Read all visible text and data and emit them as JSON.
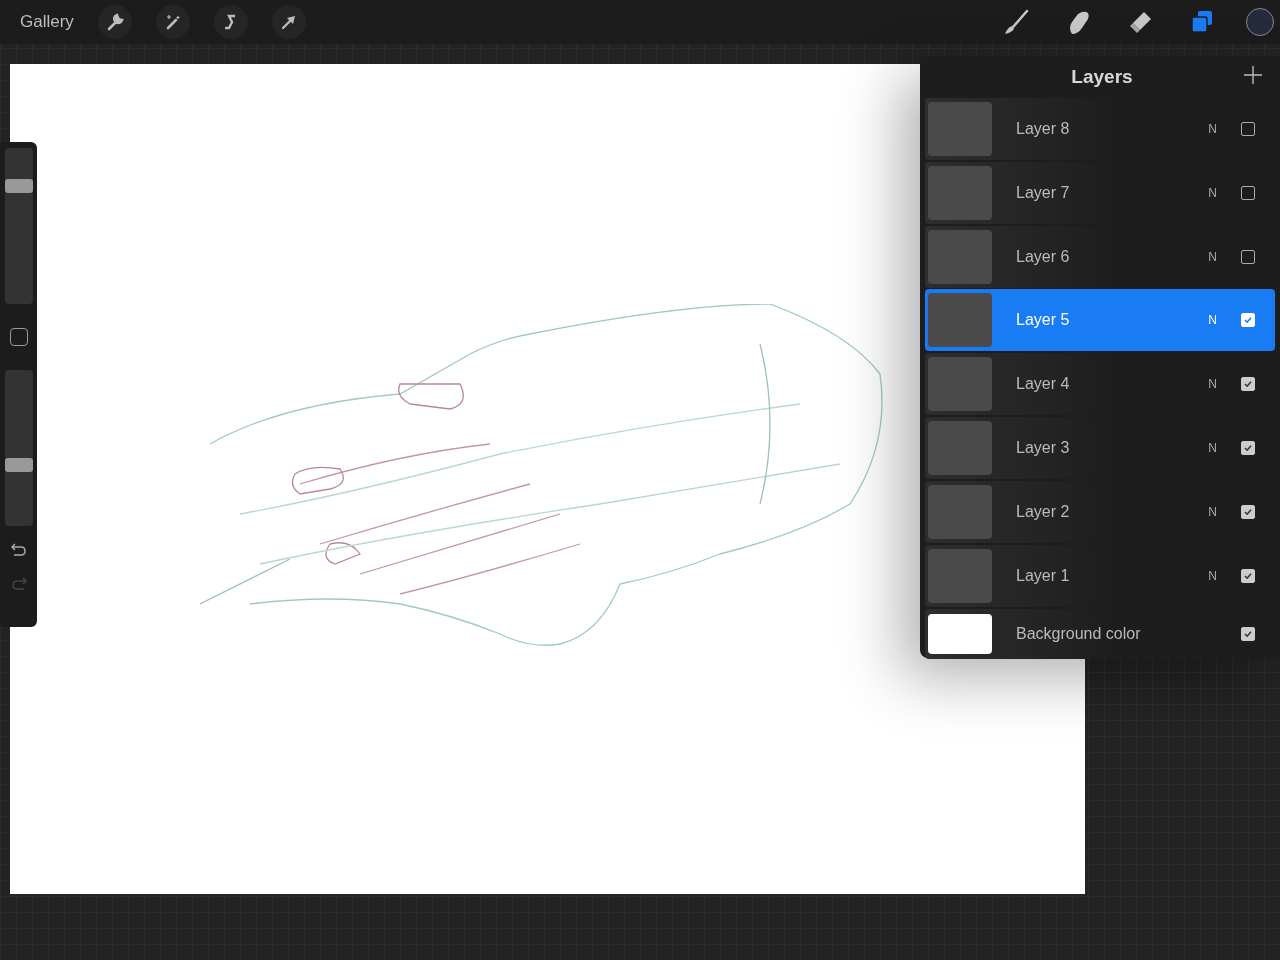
{
  "top_bar": {
    "gallery": "Gallery",
    "left_tools": [
      {
        "kind": "wrench"
      },
      {
        "kind": "wand"
      },
      {
        "kind": "selection"
      },
      {
        "kind": "arrow"
      }
    ],
    "right_tools": [
      {
        "kind": "brush",
        "selected": false
      },
      {
        "kind": "smudge",
        "selected": false
      },
      {
        "kind": "eraser",
        "selected": false
      },
      {
        "kind": "layers",
        "selected": true
      }
    ],
    "color_swatch": {
      "color": "#272a3d"
    }
  },
  "sidebar": {
    "brush_size": {
      "level": 0.78
    },
    "opacity": {
      "level": 0.38
    },
    "redo_disabled": true
  },
  "layers_panel": {
    "title": "Layers",
    "layers": [
      {
        "kind": "layer",
        "name": "Layer 8",
        "blend": "N",
        "visible": false,
        "selected": false
      },
      {
        "kind": "layer",
        "name": "Layer 7",
        "blend": "N",
        "visible": false,
        "selected": false
      },
      {
        "kind": "layer",
        "name": "Layer 6",
        "blend": "N",
        "visible": false,
        "selected": false
      },
      {
        "kind": "layer",
        "name": "Layer 5",
        "blend": "N",
        "visible": true,
        "selected": true
      },
      {
        "kind": "layer",
        "name": "Layer 4",
        "blend": "N",
        "visible": true,
        "selected": false
      },
      {
        "kind": "layer",
        "name": "Layer 3",
        "blend": "N",
        "visible": true,
        "selected": false
      },
      {
        "kind": "layer",
        "name": "Layer 2",
        "blend": "N",
        "visible": true,
        "selected": false
      },
      {
        "kind": "layer",
        "name": "Layer 1",
        "blend": "N",
        "visible": true,
        "selected": false
      },
      {
        "kind": "background",
        "name": "Background color",
        "visible": true,
        "selected": false
      }
    ]
  }
}
